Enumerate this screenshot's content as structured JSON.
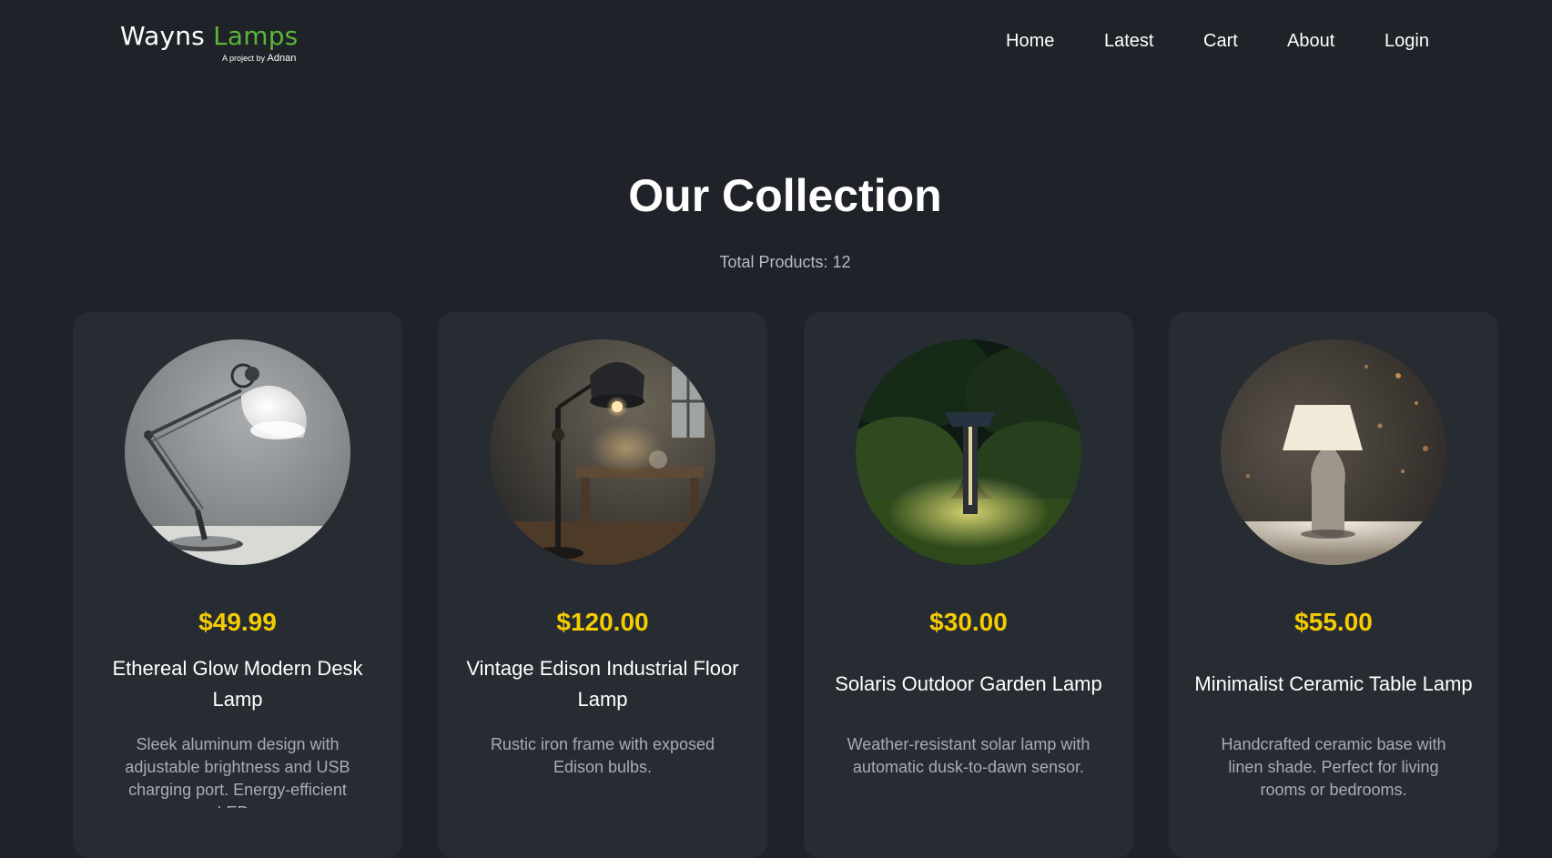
{
  "brand": {
    "name_part1": "Wayns",
    "name_part2": "Lamps",
    "tagline_prefix": "A project by",
    "tagline_author": "Adnan",
    "accent_color": "#5cb53a"
  },
  "nav": {
    "items": [
      {
        "label": "Home"
      },
      {
        "label": "Latest"
      },
      {
        "label": "Cart"
      },
      {
        "label": "About"
      },
      {
        "label": "Login"
      }
    ]
  },
  "page": {
    "title": "Our Collection",
    "total_products": "Total Products: 12"
  },
  "products": [
    {
      "price": "$49.99",
      "name": "Ethereal Glow Modern Desk Lamp",
      "description": "Sleek aluminum design with adjustable brightness and USB charging port. Energy-efficient LED..",
      "image_icon": "desk-lamp-image"
    },
    {
      "price": "$120.00",
      "name": "Vintage Edison Industrial Floor Lamp",
      "description": "Rustic iron frame with exposed Edison bulbs.",
      "image_icon": "floor-lamp-image"
    },
    {
      "price": "$30.00",
      "name": "Solaris Outdoor Garden Lamp",
      "description": "Weather-resistant solar lamp with automatic dusk-to-dawn sensor.",
      "image_icon": "garden-lamp-image"
    },
    {
      "price": "$55.00",
      "name": "Minimalist Ceramic Table Lamp",
      "description": "Handcrafted ceramic base with linen shade. Perfect for living rooms or bedrooms.",
      "image_icon": "table-lamp-image"
    }
  ],
  "colors": {
    "background": "#1f2228",
    "card": "#272b32",
    "price": "#f5cc00"
  }
}
